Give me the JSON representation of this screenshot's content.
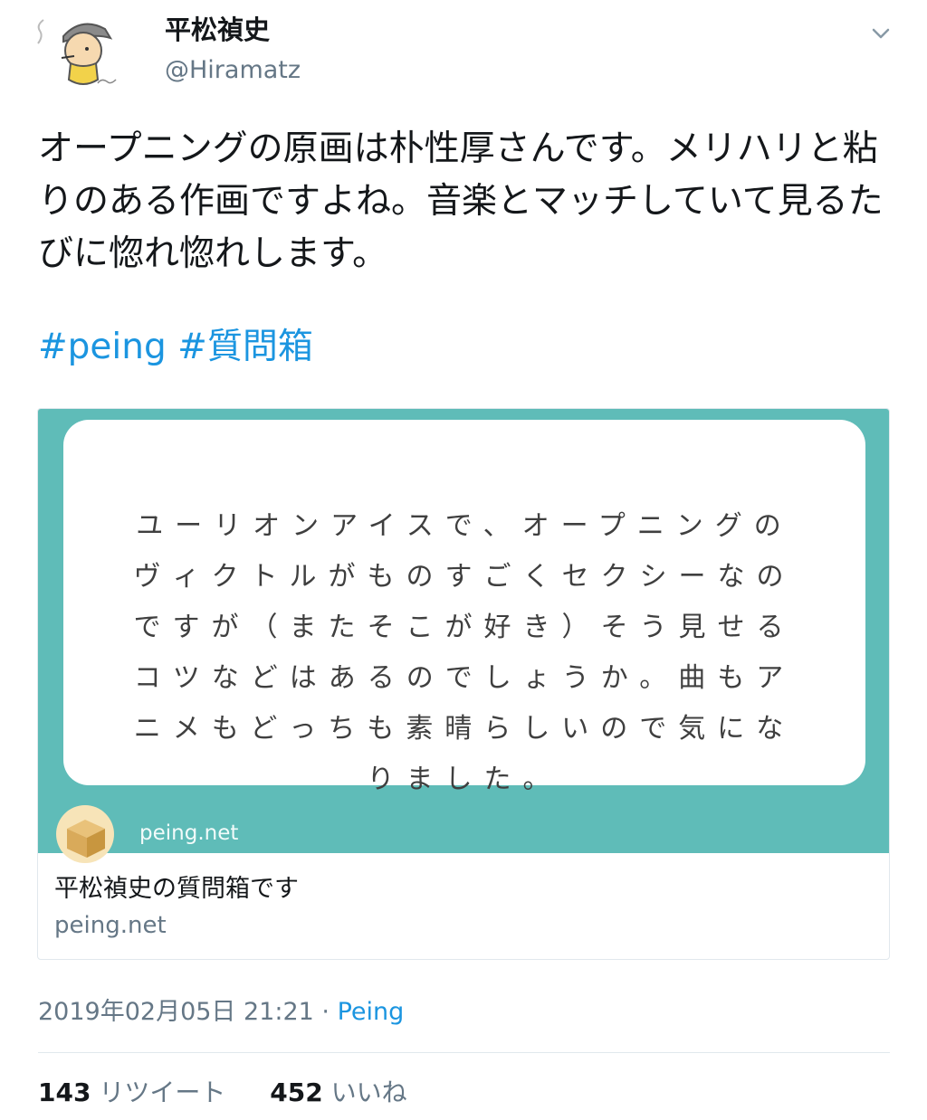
{
  "user": {
    "display_name": "平松禎史",
    "handle": "@Hiramatz"
  },
  "tweet": {
    "text": "オープニングの原画は朴性厚さんです。メリハリと粘りのある作画ですよね。音楽とマッチしていて見るたびに惚れ惚れします。",
    "hashtags": [
      "#peing",
      "#質問箱"
    ]
  },
  "card": {
    "question": "ユーリオンアイスで、オープニングのヴィクトルがものすごくセクシーなのですが（またそこが好き）そう見せるコツなどはあるのでしょうか。曲もアニメもどっちも素晴らしいので気になりました。",
    "image_domain": "peing.net",
    "title": "平松禎史の質問箱です",
    "domain": "peing.net",
    "colors": {
      "background": "#5fbcb8",
      "box": "#ffffff"
    }
  },
  "meta": {
    "timestamp": "2019年02月05日 21:21",
    "separator": "·",
    "source": "Peing"
  },
  "stats": {
    "retweets_count": "143",
    "retweets_label": "リツイート",
    "likes_count": "452",
    "likes_label": "いいね"
  },
  "colors": {
    "link": "#1b95e0",
    "secondary": "#657786",
    "text": "#14171a"
  },
  "icons": [
    "avatar",
    "chevron-down-icon",
    "peing-logo"
  ]
}
